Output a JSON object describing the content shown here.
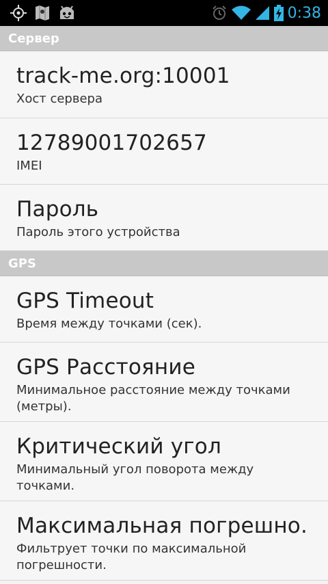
{
  "status_bar": {
    "time": "0:38",
    "icons": [
      "gps-icon",
      "maps-icon",
      "android-icon",
      "alarm-icon",
      "wifi-icon",
      "signal-icon",
      "battery-charging-icon"
    ],
    "accent_color": "#33b5e5"
  },
  "sections": [
    {
      "header": "Сервер",
      "items": [
        {
          "title": "track-me.org:10001",
          "summary": "Хост сервера"
        },
        {
          "title": "12789001702657",
          "summary": "IMEI"
        },
        {
          "title": "Пароль",
          "summary": "Пароль этого устройства"
        }
      ]
    },
    {
      "header": "GPS",
      "items": [
        {
          "title": "GPS Timeout",
          "summary": "Время между точками (сек)."
        },
        {
          "title": "GPS Расстояние",
          "summary": "Минимальное расстояние между точками (метры)."
        },
        {
          "title": "Критический угол",
          "summary": "Минимальный угол поворота между точками."
        },
        {
          "title": "Максимальная погрешно.",
          "summary": "Фильтрует точки по максимальной погрешности."
        }
      ]
    }
  ]
}
